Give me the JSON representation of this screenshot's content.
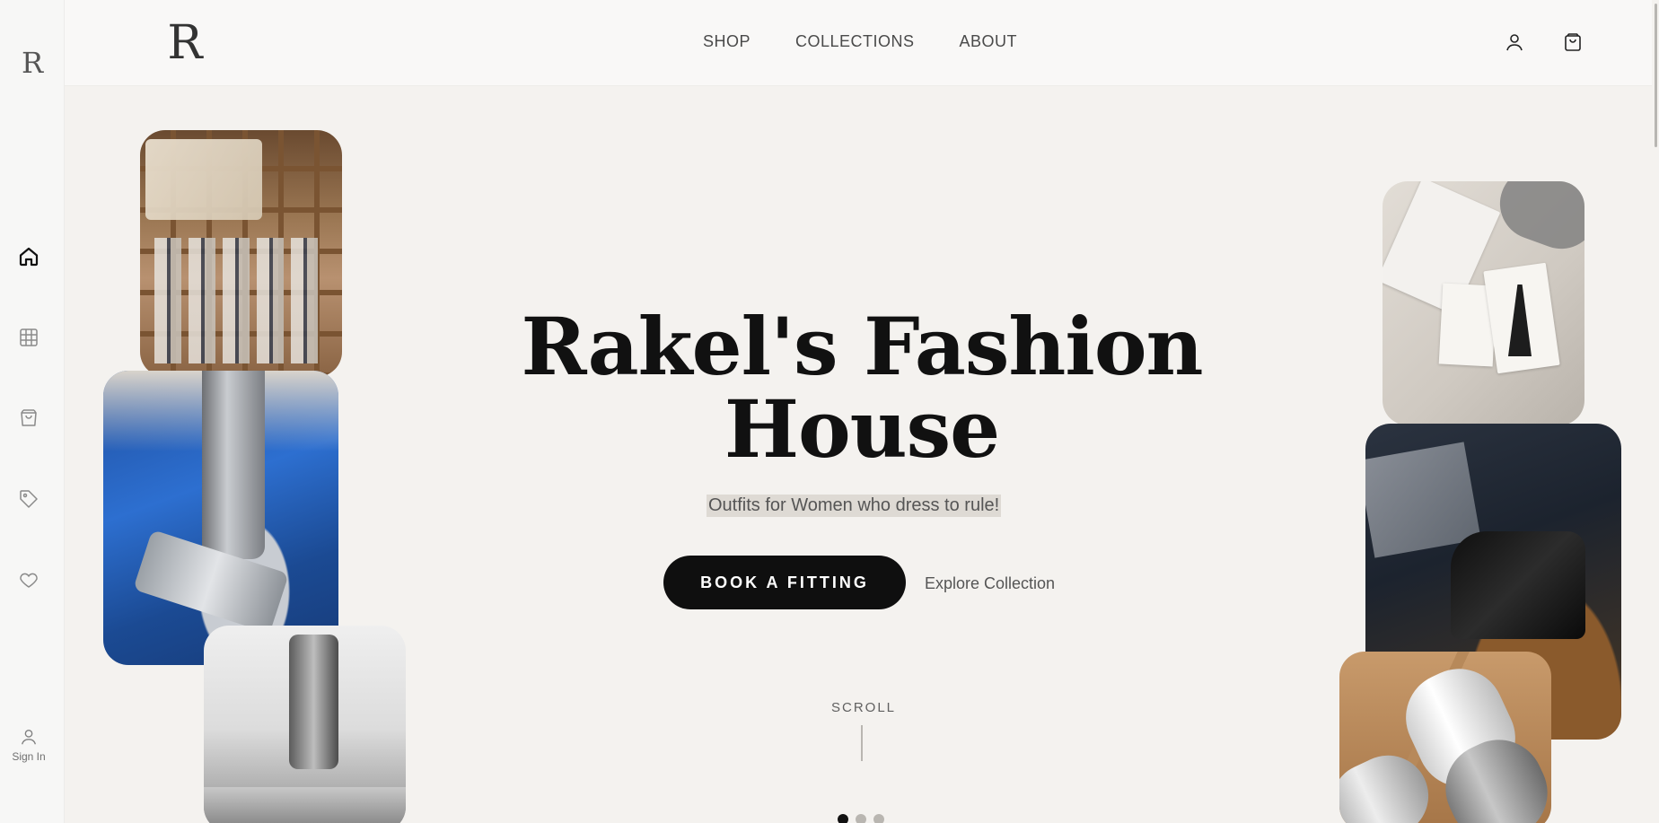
{
  "sidebar": {
    "logo_mark": "R",
    "items": [
      {
        "name": "home",
        "icon": "home-icon",
        "active": true
      },
      {
        "name": "grid",
        "icon": "grid-icon",
        "active": false
      },
      {
        "name": "bag",
        "icon": "shopping-bag-icon",
        "active": false
      },
      {
        "name": "tag",
        "icon": "tag-icon",
        "active": false
      },
      {
        "name": "favorites",
        "icon": "heart-icon",
        "active": false
      }
    ],
    "signin_label": "Sign In"
  },
  "header": {
    "logo_mark": "R",
    "nav": [
      "SHOP",
      "COLLECTIONS",
      "ABOUT"
    ],
    "icons": [
      "user-icon",
      "shopping-bag-icon"
    ]
  },
  "hero": {
    "title_line1": "Rakel's Fashion",
    "title_line2": "House",
    "tagline": "Outfits for Women who dress to rule!",
    "primary_button": "BOOK A FITTING",
    "secondary_link": "Explore Collection",
    "scroll_label": "SCROLL",
    "carousel": {
      "total": 3,
      "active_index": 0
    }
  },
  "colors": {
    "background": "#f4f2ef",
    "primary": "#0f0f0f",
    "text": "#111111",
    "muted": "#555555",
    "tagline_highlight": "#dedad4"
  }
}
